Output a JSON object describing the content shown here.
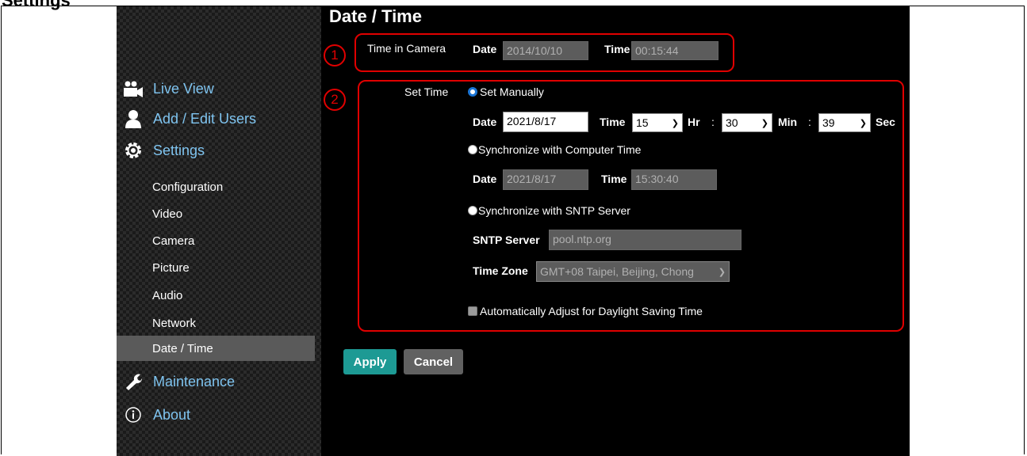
{
  "header": {
    "fragment_title": "Settings",
    "page_title": "Date / Time"
  },
  "sidebar": {
    "main_items": [
      {
        "label": "Live View",
        "icon": "video-camera-icon"
      },
      {
        "label": "Add / Edit Users",
        "icon": "user-icon"
      },
      {
        "label": "Settings",
        "icon": "gear-icon"
      },
      {
        "label": "Maintenance",
        "icon": "wrench-icon"
      },
      {
        "label": "About",
        "icon": "info-icon"
      }
    ],
    "sub_items": [
      {
        "label": "Configuration"
      },
      {
        "label": "Video"
      },
      {
        "label": "Camera"
      },
      {
        "label": "Picture"
      },
      {
        "label": "Audio"
      },
      {
        "label": "Network"
      },
      {
        "label": "Date / Time",
        "active": true
      }
    ]
  },
  "annotations": {
    "badge1": "1",
    "badge2": "2",
    "color": "#e00000"
  },
  "time_in_camera": {
    "label": "Time in Camera",
    "date_label": "Date",
    "date_value": "2014/10/10",
    "time_label": "Time",
    "time_value": "00:15:44"
  },
  "set_time": {
    "label": "Set Time",
    "manual": {
      "label": "Set Manually",
      "selected": true,
      "date_label": "Date",
      "date_value": "2021/8/17",
      "time_label": "Time",
      "hour": "15",
      "hr_label": "Hr",
      "minute": "30",
      "min_label": "Min",
      "second": "39",
      "sec_label": "Sec",
      "colon": ":"
    },
    "computer": {
      "label": "Synchronize with Computer Time",
      "selected": false,
      "date_label": "Date",
      "date_value": "2021/8/17",
      "time_label": "Time",
      "time_value": "15:30:40"
    },
    "sntp": {
      "label": "Synchronize with SNTP Server",
      "selected": false,
      "server_label": "SNTP Server",
      "server_value": "pool.ntp.org",
      "zone_label": "Time Zone",
      "zone_value": "GMT+08 Taipei, Beijing, Chong"
    },
    "dst": {
      "label": "Automatically Adjust for Daylight Saving Time",
      "checked": false
    }
  },
  "buttons": {
    "apply": "Apply",
    "cancel": "Cancel"
  },
  "colors": {
    "accent": "#1d9a94",
    "nav_text": "#7fc4f0",
    "radio": "#1a74d4"
  }
}
